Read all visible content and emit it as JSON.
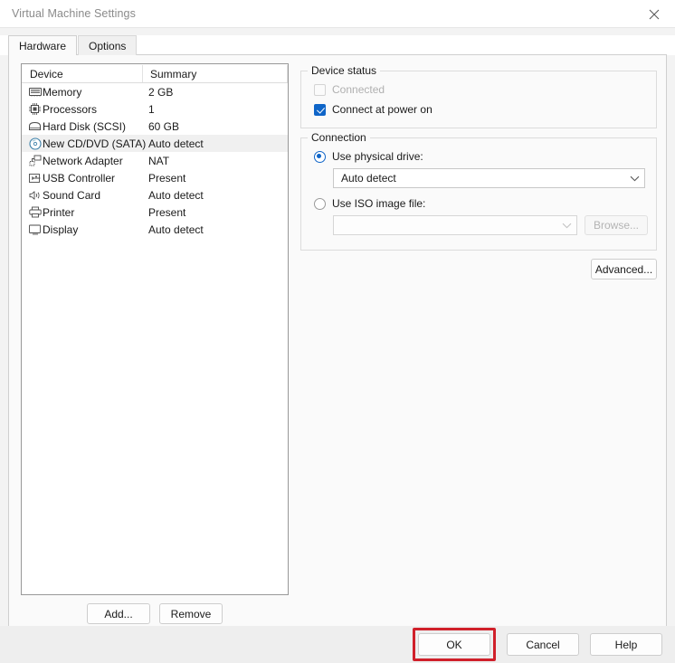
{
  "window": {
    "title": "Virtual Machine Settings",
    "close_icon": "close-icon"
  },
  "tabs": [
    {
      "label": "Hardware",
      "selected": true
    },
    {
      "label": "Options",
      "selected": false
    }
  ],
  "device_list": {
    "columns": [
      "Device",
      "Summary"
    ],
    "rows": [
      {
        "icon": "memory-icon",
        "name": "Memory",
        "summary": "2 GB",
        "selected": false
      },
      {
        "icon": "processor-icon",
        "name": "Processors",
        "summary": "1",
        "selected": false
      },
      {
        "icon": "hard-disk-icon",
        "name": "Hard Disk (SCSI)",
        "summary": "60 GB",
        "selected": false
      },
      {
        "icon": "cd-dvd-icon",
        "name": "New CD/DVD (SATA)",
        "summary": "Auto detect",
        "selected": true
      },
      {
        "icon": "network-adapter-icon",
        "name": "Network Adapter",
        "summary": "NAT",
        "selected": false
      },
      {
        "icon": "usb-controller-icon",
        "name": "USB Controller",
        "summary": "Present",
        "selected": false
      },
      {
        "icon": "sound-card-icon",
        "name": "Sound Card",
        "summary": "Auto detect",
        "selected": false
      },
      {
        "icon": "printer-icon",
        "name": "Printer",
        "summary": "Present",
        "selected": false
      },
      {
        "icon": "display-icon",
        "name": "Display",
        "summary": "Auto detect",
        "selected": false
      }
    ],
    "add_button": "Add...",
    "remove_button": "Remove"
  },
  "device_status": {
    "group_title": "Device status",
    "connected": {
      "label": "Connected",
      "checked": false,
      "disabled": true
    },
    "connect_at_power_on": {
      "label": "Connect at power on",
      "checked": true,
      "disabled": false
    }
  },
  "connection": {
    "group_title": "Connection",
    "use_physical_drive": {
      "label": "Use physical drive:",
      "selected": true
    },
    "physical_drive_value": "Auto detect",
    "use_iso_image": {
      "label": "Use ISO image file:",
      "selected": false
    },
    "iso_path_value": "",
    "browse_button": "Browse...",
    "advanced_button": "Advanced..."
  },
  "footer": {
    "ok": "OK",
    "cancel": "Cancel",
    "help": "Help",
    "highlight_color": "#d0202a",
    "highlighted_button": "OK"
  },
  "colors": {
    "accent": "#0f65c8",
    "dialog_bg": "#f3f3f3",
    "panel_bg": "#fafafa",
    "selection_bg": "#f0f0f0"
  }
}
